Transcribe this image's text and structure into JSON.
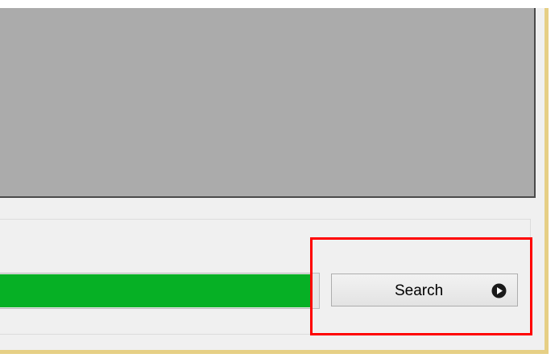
{
  "toolbar": {
    "search_label": "Search",
    "search_icon": "play-circle-icon"
  },
  "progress": {
    "value_percent": 100
  },
  "colors": {
    "viewer_background": "#ababab",
    "progress_fill": "#06b025",
    "highlight": "#ff0000",
    "window_frame": "#e6cf85"
  }
}
